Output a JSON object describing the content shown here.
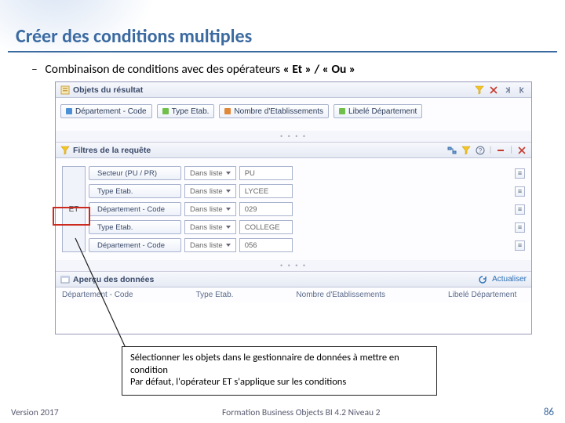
{
  "title": "Créer des conditions multiples",
  "subtitle_prefix": "Combinaison de conditions avec des opérateurs ",
  "subtitle_bold": "« Et » / « Ou »",
  "panels": {
    "results": {
      "label": "Objets du résultat"
    },
    "filters": {
      "label": "Filtres de la requête"
    },
    "preview": {
      "label": "Aperçu des données",
      "refresh": "Actualiser"
    }
  },
  "result_objects": [
    {
      "label": "Département - Code",
      "kind": "dim"
    },
    {
      "label": "Type Etab.",
      "kind": "attr"
    },
    {
      "label": "Nombre d'Etablissements",
      "kind": "msr"
    },
    {
      "label": "Libelé Département",
      "kind": "attr"
    }
  ],
  "operator_label": "ET",
  "op_text": "Dans liste",
  "filter_rows": [
    {
      "name": "Secteur (PU / PR)",
      "kind": "dim",
      "value": "PU"
    },
    {
      "name": "Type Etab.",
      "kind": "attr",
      "value": "LYCEE"
    },
    {
      "name": "Département - Code",
      "kind": "dim",
      "value": "029"
    },
    {
      "name": "Type Etab.",
      "kind": "attr",
      "value": "COLLEGE"
    },
    {
      "name": "Département - Code",
      "kind": "dim",
      "value": "056"
    }
  ],
  "preview_cols": [
    "Département - Code",
    "Type Etab.",
    "Nombre d'Etablissements",
    "Libelé Département"
  ],
  "callout_l1": "Sélectionner les objets dans le gestionnaire de données à mettre en condition",
  "callout_l2": "Par défaut, l'opérateur ET s'applique sur les conditions",
  "footer": {
    "version": "Version 2017",
    "mid": "Formation Business Objects BI 4.2 Niveau 2",
    "page": "86"
  }
}
